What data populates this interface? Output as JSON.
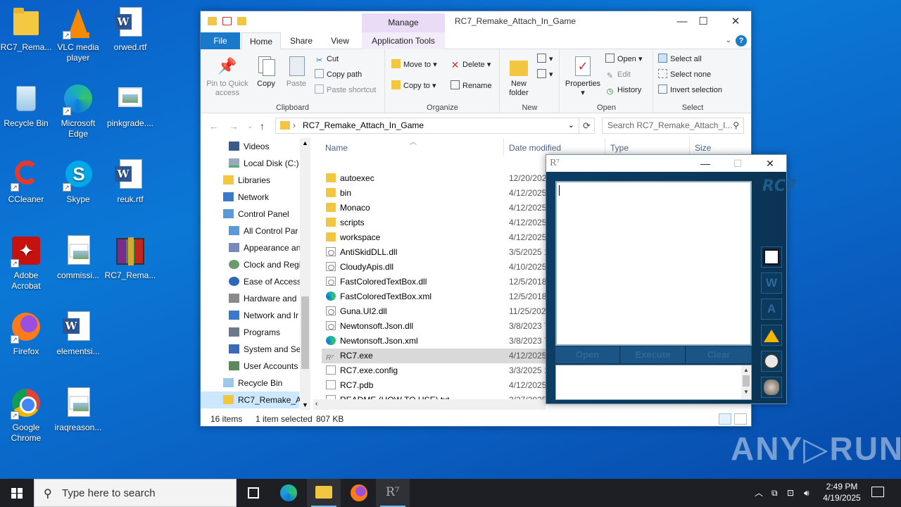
{
  "desktop": {
    "icons": [
      {
        "label": "RC7_Rema...",
        "icon": "folder-icon"
      },
      {
        "label": "VLC media player",
        "icon": "vlc-icon"
      },
      {
        "label": "orwed.rtf",
        "icon": "word-doc-icon"
      },
      {
        "label": "Recycle Bin",
        "icon": "recycle-bin-icon"
      },
      {
        "label": "Microsoft Edge",
        "icon": "edge-icon"
      },
      {
        "label": "pinkgrade....",
        "icon": "image-file-icon"
      },
      {
        "label": "CCleaner",
        "icon": "ccleaner-icon"
      },
      {
        "label": "Skype",
        "icon": "skype-icon"
      },
      {
        "label": "reuk.rtf",
        "icon": "word-doc-icon"
      },
      {
        "label": "Adobe Acrobat",
        "icon": "acrobat-icon"
      },
      {
        "label": "commissi...",
        "icon": "image-file-icon"
      },
      {
        "label": "RC7_Rema...",
        "icon": "winrar-icon"
      },
      {
        "label": "Firefox",
        "icon": "firefox-icon"
      },
      {
        "label": "elementsi...",
        "icon": "word-doc-icon"
      },
      {
        "label": "Google Chrome",
        "icon": "chrome-icon"
      },
      {
        "label": "iraqreason...",
        "icon": "image-file-icon"
      }
    ]
  },
  "explorer": {
    "title": "RC7_Remake_Attach_In_Game",
    "manage_label": "Manage",
    "tabs": {
      "file": "File",
      "home": "Home",
      "share": "Share",
      "view": "View",
      "app_tools": "Application Tools"
    },
    "clipboard": {
      "pin": "Pin to Quick access",
      "copy": "Copy",
      "paste": "Paste",
      "cut": "Cut",
      "copy_path": "Copy path",
      "paste_shortcut": "Paste shortcut",
      "group": "Clipboard"
    },
    "organize": {
      "move_to": "Move to",
      "copy_to": "Copy to",
      "delete": "Delete",
      "rename": "Rename",
      "group": "Organize"
    },
    "new": {
      "new_folder": "New folder",
      "group": "New"
    },
    "open": {
      "properties": "Properties",
      "open": "Open",
      "edit": "Edit",
      "history": "History",
      "group": "Open"
    },
    "select": {
      "select_all": "Select all",
      "select_none": "Select none",
      "invert": "Invert selection",
      "group": "Select"
    },
    "address": {
      "path": "RC7_Remake_Attach_In_Game",
      "search_placeholder": "Search RC7_Remake_Attach_I..."
    },
    "nav": [
      {
        "label": "Videos"
      },
      {
        "label": "Local Disk (C:)"
      },
      {
        "label": "Libraries"
      },
      {
        "label": "Network"
      },
      {
        "label": "Control Panel"
      },
      {
        "label": "All Control Par"
      },
      {
        "label": "Appearance an"
      },
      {
        "label": "Clock and Regi"
      },
      {
        "label": "Ease of Access"
      },
      {
        "label": "Hardware and"
      },
      {
        "label": "Network and Ir"
      },
      {
        "label": "Programs"
      },
      {
        "label": "System and Se"
      },
      {
        "label": "User Accounts"
      },
      {
        "label": "Recycle Bin"
      },
      {
        "label": "RC7_Remake_At"
      }
    ],
    "columns": {
      "name": "Name",
      "date": "Date modified",
      "type": "Type",
      "size": "Size"
    },
    "files": [
      {
        "name": "autoexec",
        "date": "12/20/202",
        "icon": "folder"
      },
      {
        "name": "bin",
        "date": "4/12/2025",
        "icon": "folder"
      },
      {
        "name": "Monaco",
        "date": "4/12/2025",
        "icon": "folder"
      },
      {
        "name": "scripts",
        "date": "4/12/2025",
        "icon": "folder"
      },
      {
        "name": "workspace",
        "date": "4/12/2025",
        "icon": "folder"
      },
      {
        "name": "AntiSkidDLL.dll",
        "date": "3/5/2025 1",
        "icon": "dll"
      },
      {
        "name": "CloudyApis.dll",
        "date": "4/10/2025",
        "icon": "dll"
      },
      {
        "name": "FastColoredTextBox.dll",
        "date": "12/5/2018",
        "icon": "dll"
      },
      {
        "name": "FastColoredTextBox.xml",
        "date": "12/5/2018",
        "icon": "edge"
      },
      {
        "name": "Guna.UI2.dll",
        "date": "11/25/202",
        "icon": "dll"
      },
      {
        "name": "Newtonsoft.Json.dll",
        "date": "3/8/2023 7",
        "icon": "dll"
      },
      {
        "name": "Newtonsoft.Json.xml",
        "date": "3/8/2023 7",
        "icon": "edge"
      },
      {
        "name": "RC7.exe",
        "date": "4/12/2025",
        "icon": "exe"
      },
      {
        "name": "RC7.exe.config",
        "date": "3/3/2025 1",
        "icon": "txt"
      },
      {
        "name": "RC7.pdb",
        "date": "4/12/2025",
        "icon": "txt"
      },
      {
        "name": "README (HOW TO USE).txt",
        "date": "3/27/2025",
        "icon": "txt"
      }
    ],
    "status": {
      "count": "16 items",
      "selected": "1 item selected",
      "size": "807 KB"
    }
  },
  "rc7": {
    "logo": "R⁷",
    "brand": "RC7",
    "buttons": {
      "open": "Open",
      "execute": "Execute",
      "clear": "Clear"
    },
    "side": {
      "w": "W",
      "a": "A"
    }
  },
  "taskbar": {
    "search_placeholder": "Type here to search",
    "time": "2:49 PM",
    "date": "4/19/2025",
    "rc7_label": "R⁷"
  },
  "watermark": "ANY▷RUN"
}
